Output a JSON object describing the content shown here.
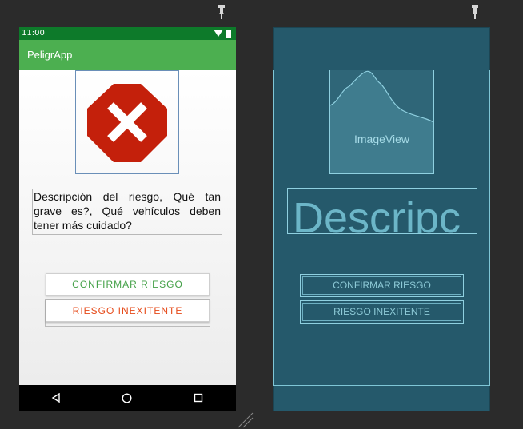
{
  "status_bar": {
    "time": "11:00"
  },
  "app_bar": {
    "title": "PeligrApp"
  },
  "description": "Descripción del riesgo, Qué tan grave es?, Qué vehículos deben tener más cuidado?",
  "buttons": {
    "confirm": "CONFIRMAR RIESGO",
    "nonexistent": "RIESGO INEXITENTE"
  },
  "blueprint": {
    "image_label": "ImageView",
    "description_label": "Descripc",
    "confirm": "CONFIRMAR RIESGO",
    "nonexistent": "RIESGO INEXITENTE"
  },
  "colors": {
    "status_bar": "#0d7a2a",
    "app_bar": "#4caf50",
    "confirm_text": "#43a047",
    "nonexistent_text": "#e64a19",
    "stop_sign": "#c4200b",
    "blueprint_bg": "#25596b"
  },
  "icons": [
    "pin-icon",
    "stop-sign-x-icon",
    "wifi-icon",
    "battery-icon",
    "back-icon",
    "home-icon",
    "recents-icon"
  ]
}
